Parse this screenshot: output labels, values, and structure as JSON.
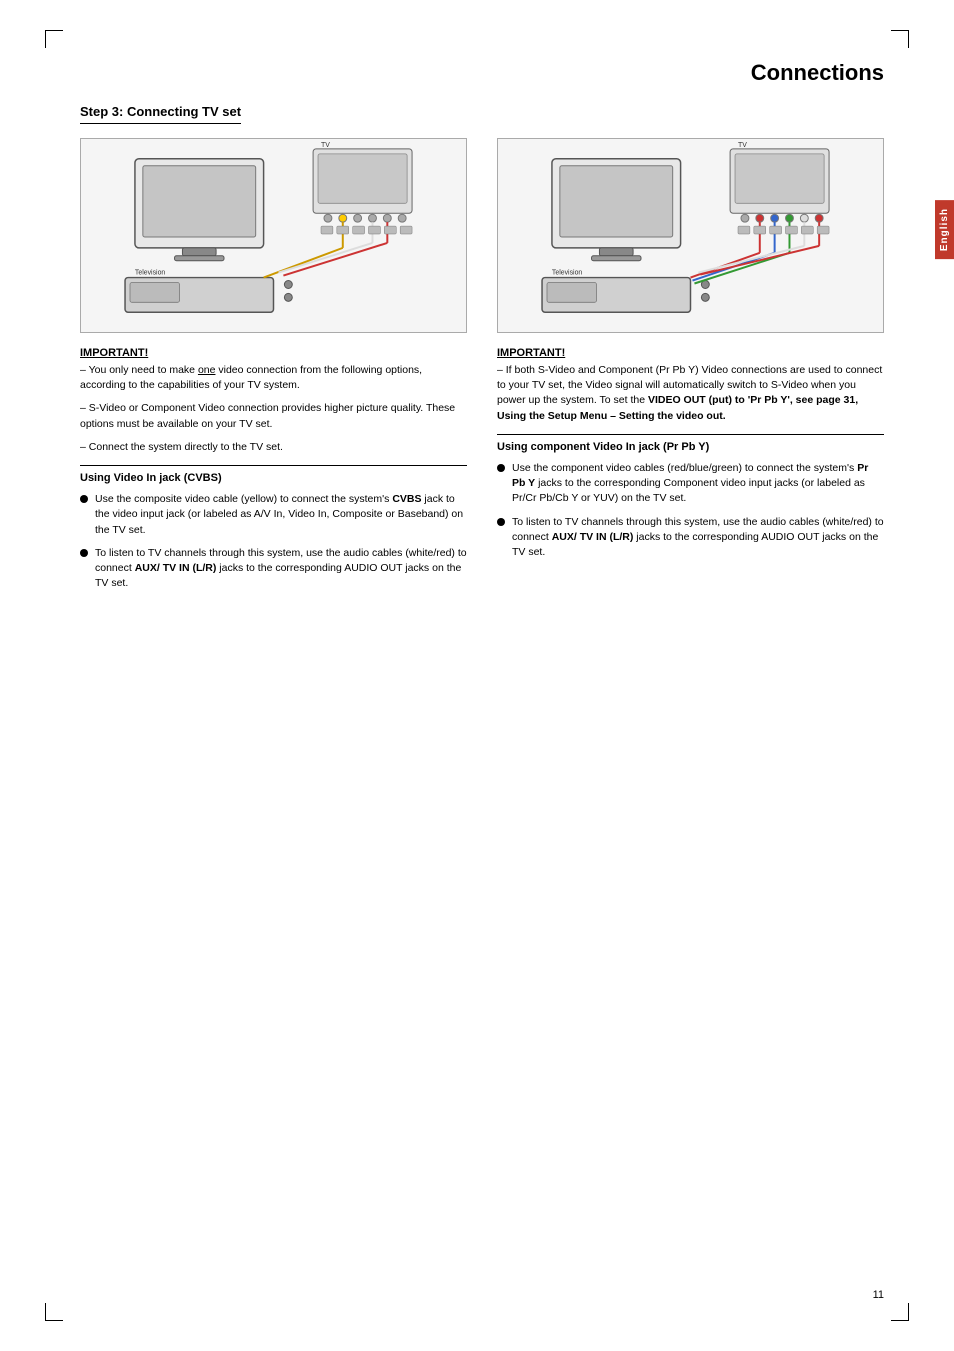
{
  "page": {
    "title": "Connections",
    "number": "11",
    "english_tab": "English"
  },
  "step": {
    "label": "Step 3: Connecting TV set"
  },
  "left_column": {
    "important_head": "IMPORTANT!",
    "important_paragraphs": [
      {
        "dash": "–",
        "text_before": "You only need to make ",
        "text_underline": "one",
        "text_after": " video connection from the following options, according to the capabilities of your TV system."
      },
      {
        "dash": "–",
        "text": "S-Video or Component Video connection provides higher picture quality. These options must be available on your TV set."
      },
      {
        "dash": "–",
        "text": "Connect the system directly to the TV set."
      }
    ],
    "sub_heading": "Using Video In jack (CVBS)",
    "bullets": [
      {
        "text_before": "Use the composite video cable (yellow) to connect the system's ",
        "bold": "CVBS",
        "text_after": " jack to the video input jack (or labeled as A/V In, Video In, Composite or Baseband) on the TV set."
      },
      {
        "text_before": "To listen to TV channels through this system, use the audio cables (white/red) to connect ",
        "bold": "AUX/ TV IN (L/R)",
        "text_after": " jacks to the corresponding AUDIO OUT jacks on the TV set."
      }
    ]
  },
  "right_column": {
    "important_head": "IMPORTANT!",
    "important_text": "– If both S-Video and Component (Pr Pb Y) Video connections are used to connect to your TV set, the Video signal will automatically switch to S-Video when you power up the system. To set the VIDEO OUT (put) to 'Pr Pb Y', see page 31, Using the Setup Menu – Setting the video out.",
    "sub_heading": "Using component Video In jack (Pr Pb Y)",
    "bullets": [
      {
        "text_before": "Use the component video cables (red/blue/green) to connect the system's ",
        "bold": "Pr Pb Y",
        "text_after": " jacks to the corresponding Component video input jacks (or labeled as Pr/Cr Pb/Cb Y or YUV) on the TV set."
      },
      {
        "text_before": "To listen to TV channels through this system, use the audio cables (white/red) to connect ",
        "bold": "AUX/ TV IN (L/R)",
        "text_after": " jacks to the corresponding AUDIO OUT jacks on the TV set."
      }
    ]
  }
}
